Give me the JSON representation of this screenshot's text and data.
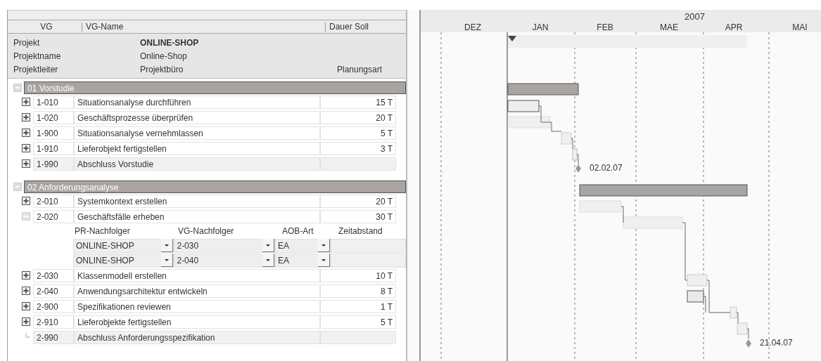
{
  "columns": [
    "VG",
    "VG-Name",
    "Dauer Soll"
  ],
  "project": [
    {
      "label": "Projekt",
      "value": "ONLINE-SHOP",
      "bold": true
    },
    {
      "label": "Projektname",
      "value": "Online-Shop",
      "bold": false
    },
    {
      "label": "Projektleiter",
      "value": "Projektbüro",
      "bold": false,
      "extra": "Planungsart"
    }
  ],
  "groups": [
    {
      "title": "01 Vorstudie",
      "expanded": true,
      "tasks": [
        {
          "id": "1-010",
          "name": "Situationsanalyse durchführen",
          "duration": "15 T",
          "kind": "task",
          "expandable": true,
          "expanded": false
        },
        {
          "id": "1-020",
          "name": "Geschäftsprozesse überprüfen",
          "duration": "20 T",
          "kind": "task",
          "expandable": true,
          "expanded": false
        },
        {
          "id": "1-900",
          "name": "Situationsanalyse vernehmlassen",
          "duration": "5 T",
          "kind": "task",
          "expandable": true,
          "expanded": false
        },
        {
          "id": "1-910",
          "name": "Lieferobjekt fertigstellen",
          "duration": "3 T",
          "kind": "task",
          "expandable": true,
          "expanded": false
        },
        {
          "id": "1-990",
          "name": "Abschluss Vorstudie",
          "kind": "milestone",
          "expandable": true,
          "expanded": false
        }
      ]
    },
    {
      "title": "02 Anforderungsanalyse",
      "expanded": true,
      "tasks": [
        {
          "id": "2-010",
          "name": "Systemkontext erstellen",
          "duration": "20 T",
          "kind": "task",
          "expandable": true,
          "expanded": false
        },
        {
          "id": "2-020",
          "name": "Geschäftsfälle erheben",
          "duration": "30 T",
          "kind": "task",
          "expandable": true,
          "expanded": true,
          "successors": {
            "columns": [
              "PR-Nachfolger",
              "VG-Nachfolger",
              "AOB-Art",
              "Zeitabstand"
            ],
            "rows": [
              {
                "project": "ONLINE-SHOP",
                "task": "2-030",
                "type": "EA"
              },
              {
                "project": "ONLINE-SHOP",
                "task": "2-040",
                "type": "EA"
              }
            ]
          }
        },
        {
          "id": "2-030",
          "name": "Klassenmodell erstellen",
          "duration": "10 T",
          "kind": "task",
          "expandable": true,
          "expanded": false
        },
        {
          "id": "2-040",
          "name": "Anwendungsarchitektur entwickeln",
          "duration": "8 T",
          "kind": "task",
          "expandable": true,
          "expanded": false
        },
        {
          "id": "2-900",
          "name": "Spezifikationen reviewen",
          "duration": "1 T",
          "kind": "task",
          "expandable": true,
          "expanded": false
        },
        {
          "id": "2-910",
          "name": "Lieferobjekte fertigstellen",
          "duration": "5 T",
          "kind": "task",
          "expandable": true,
          "expanded": false
        },
        {
          "id": "2-990",
          "name": "Abschluss Anforderungsspezifikation",
          "kind": "milestone",
          "expandable": false
        }
      ]
    }
  ],
  "gantt": {
    "year": "2007",
    "months": [
      "DEZ",
      "JAN",
      "FEB",
      "MAE",
      "APR",
      "MAI"
    ],
    "milestone_labels": [
      "02.02.07",
      "21.04.07"
    ]
  }
}
